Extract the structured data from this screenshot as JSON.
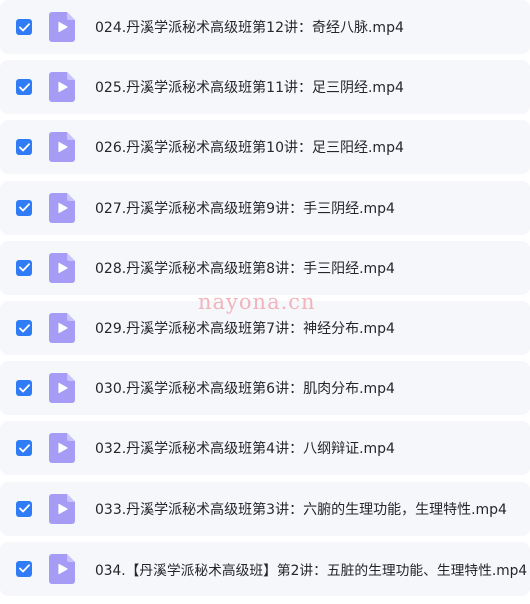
{
  "colors": {
    "row_background": "#f6f7fb",
    "checkbox_accent": "#2f7cf6",
    "file_icon": "#a69cf5",
    "text": "#25262b",
    "watermark": "#f2b4bc"
  },
  "files": [
    {
      "name": "024.丹溪学派秘术高级班第12讲：奇经八脉.mp4",
      "checked": true,
      "icon": "video-file-icon"
    },
    {
      "name": "025.丹溪学派秘术高级班第11讲：足三阴经.mp4",
      "checked": true,
      "icon": "video-file-icon"
    },
    {
      "name": "026.丹溪学派秘术高级班第10讲：足三阳经.mp4",
      "checked": true,
      "icon": "video-file-icon"
    },
    {
      "name": "027.丹溪学派秘术高级班第9讲：手三阴经.mp4",
      "checked": true,
      "icon": "video-file-icon"
    },
    {
      "name": "028.丹溪学派秘术高级班第8讲：手三阳经.mp4",
      "checked": true,
      "icon": "video-file-icon"
    },
    {
      "name": "029.丹溪学派秘术高级班第7讲：神经分布.mp4",
      "checked": true,
      "icon": "video-file-icon"
    },
    {
      "name": "030.丹溪学派秘术高级班第6讲：肌肉分布.mp4",
      "checked": true,
      "icon": "video-file-icon"
    },
    {
      "name": "032.丹溪学派秘术高级班第4讲：八纲辩证.mp4",
      "checked": true,
      "icon": "video-file-icon"
    },
    {
      "name": "033.丹溪学派秘术高级班第3讲：六腑的生理功能，生理特性.mp4",
      "checked": true,
      "icon": "video-file-icon"
    },
    {
      "name": "034.【丹溪学派秘术高级班】第2讲：五脏的生理功能、生理特性.mp4",
      "checked": true,
      "icon": "video-file-icon"
    }
  ],
  "watermark": "nayona.cn"
}
